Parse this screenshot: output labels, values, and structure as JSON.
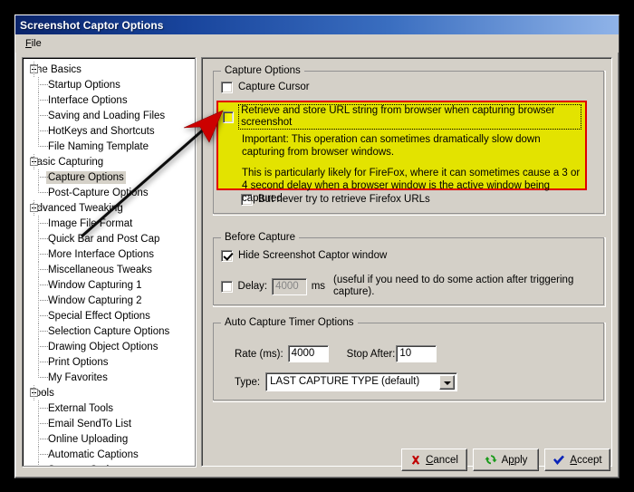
{
  "window": {
    "title": "Screenshot Captor Options",
    "menu": [
      "File"
    ]
  },
  "tree": {
    "nodes": [
      {
        "label": "The Basics",
        "level": 0,
        "expanded": true
      },
      {
        "label": "Startup Options",
        "level": 1
      },
      {
        "label": "Interface Options",
        "level": 1
      },
      {
        "label": "Saving and Loading Files",
        "level": 1
      },
      {
        "label": "HotKeys and Shortcuts",
        "level": 1
      },
      {
        "label": "File Naming Template",
        "level": 1
      },
      {
        "label": "Basic Capturing",
        "level": 0,
        "expanded": true
      },
      {
        "label": "Capture Options",
        "level": 1,
        "selected": true
      },
      {
        "label": "Post-Capture Options",
        "level": 1
      },
      {
        "label": "Advanced Tweaking",
        "level": 0,
        "expanded": true
      },
      {
        "label": "Image File Format",
        "level": 1
      },
      {
        "label": "Quick Bar and Post Cap",
        "level": 1
      },
      {
        "label": "More Interface Options",
        "level": 1
      },
      {
        "label": "Miscellaneous Tweaks",
        "level": 1
      },
      {
        "label": "Window Capturing 1",
        "level": 1
      },
      {
        "label": "Window Capturing 2",
        "level": 1
      },
      {
        "label": "Special Effect Options",
        "level": 1
      },
      {
        "label": "Selection Capture Options",
        "level": 1
      },
      {
        "label": "Drawing Object Options",
        "level": 1
      },
      {
        "label": "Print Options",
        "level": 1
      },
      {
        "label": "My Favorites",
        "level": 1
      },
      {
        "label": "Tools",
        "level": 0,
        "expanded": true
      },
      {
        "label": "External Tools",
        "level": 1
      },
      {
        "label": "Email SendTo List",
        "level": 1
      },
      {
        "label": "Online Uploading",
        "level": 1
      },
      {
        "label": "Automatic Captions",
        "level": 1
      },
      {
        "label": "Scanner Options",
        "level": 1
      }
    ]
  },
  "capture_options": {
    "group_title": "Capture Options",
    "capture_cursor": {
      "label": "Capture Cursor",
      "checked": false
    },
    "retrieve_url": {
      "label": "Retrieve and store URL string from browser when capturing browser screenshot",
      "checked": false,
      "highlighted": true
    },
    "note_1": "Important: This operation can sometimes dramatically slow down capturing from browser windows.",
    "note_2": "This is particularly likely for FireFox, where it can sometimes cause a 3  or 4 second delay when a browser window is the active window being captured.",
    "never_firefox": {
      "label": "But never try to retrieve Firefox URLs",
      "checked": false
    }
  },
  "before_capture": {
    "group_title": "Before Capture",
    "hide_window": {
      "label": "Hide Screenshot Captor window",
      "checked": true
    },
    "delay": {
      "label": "Delay:",
      "checked": false,
      "value": "4000",
      "unit": "ms",
      "hint": "(useful if you need to do some action after triggering capture)."
    }
  },
  "auto_capture": {
    "group_title": "Auto Capture Timer Options",
    "rate_label": "Rate (ms):",
    "rate_value": "4000",
    "stop_after_label": "Stop After:",
    "stop_after_value": "10",
    "type_label": "Type:",
    "type_value": "LAST CAPTURE TYPE (default)"
  },
  "buttons": {
    "cancel": {
      "pre": "",
      "accel": "C",
      "post": "ancel",
      "icon": "x-icon"
    },
    "apply": {
      "pre": "A",
      "accel": "p",
      "post": "ply",
      "icon": "refresh-icon"
    },
    "accept": {
      "pre": "",
      "accel": "A",
      "post": "ccept",
      "icon": "checkmark-icon"
    }
  },
  "colors": {
    "highlight_fill": "#e3e300",
    "highlight_border": "#e00000",
    "annotation_arrow": "#cc0000",
    "titlebar": "#0a246a",
    "face": "#d4d0c8"
  },
  "annotation": {
    "arrow": "red-arrow-pointing-to-retrieve-url-checkbox"
  }
}
